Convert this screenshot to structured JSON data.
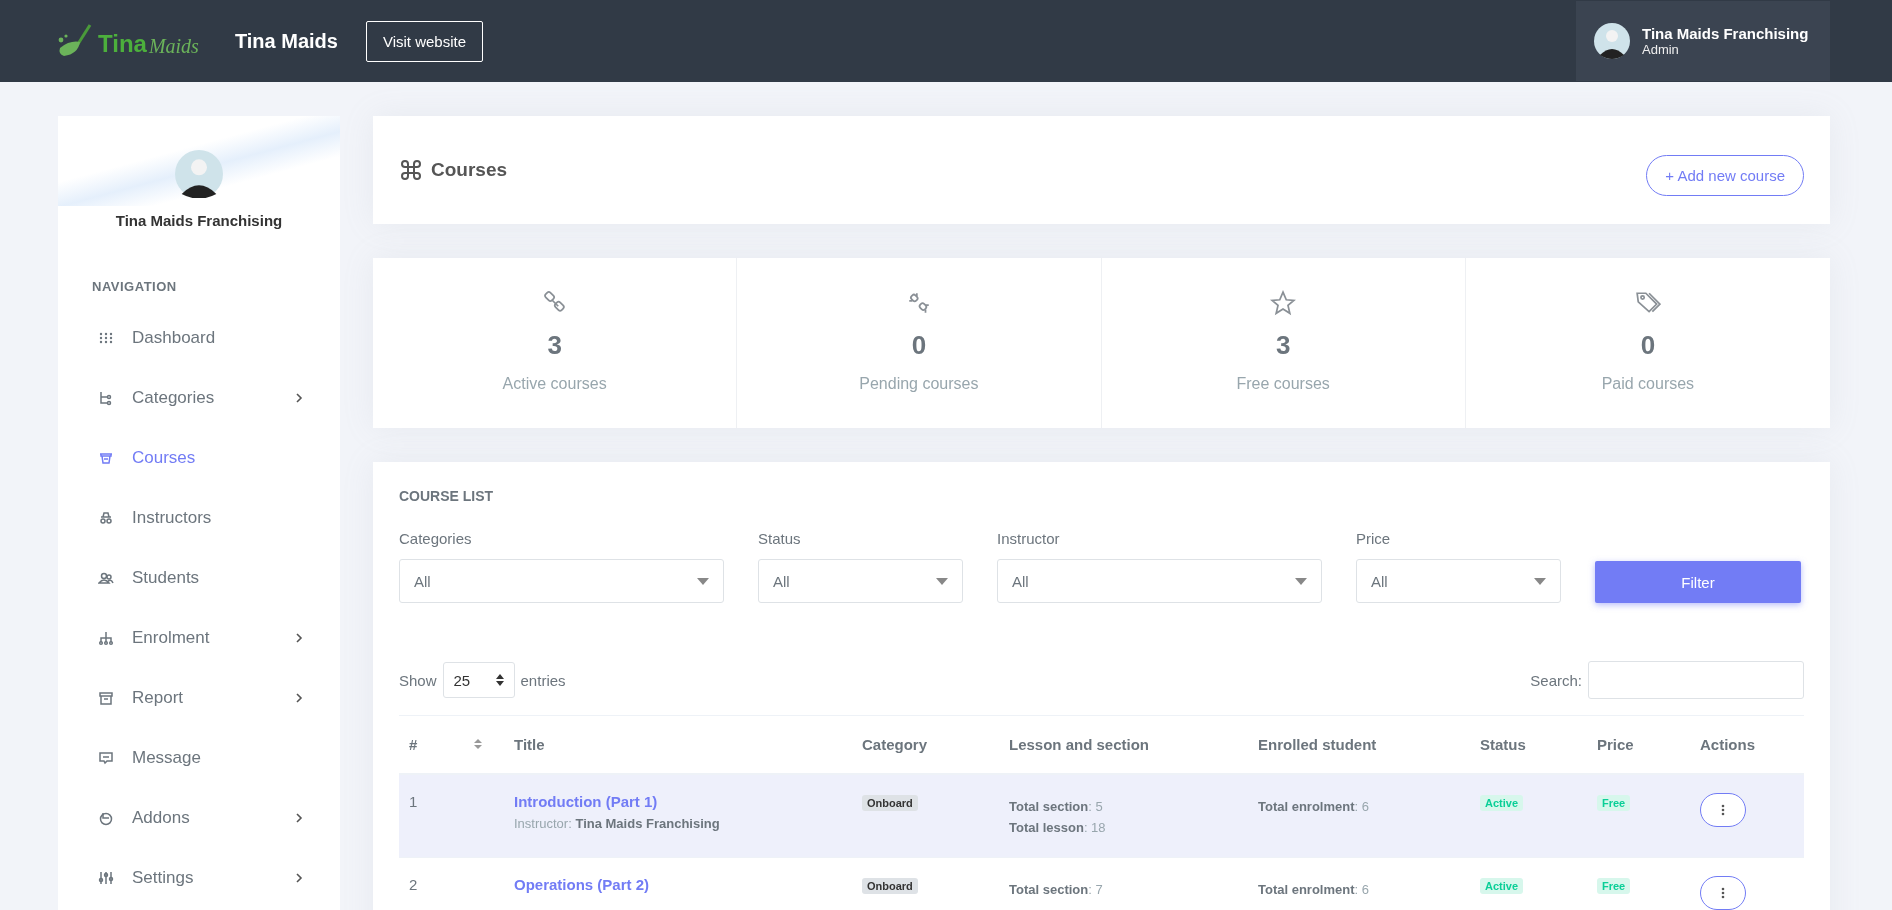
{
  "header": {
    "logo": {
      "word_1": "Tina",
      "word_2": "Maids"
    },
    "site_title": "Tina Maids",
    "visit_button": "Visit website",
    "user": {
      "name": "Tina Maids Franchising",
      "role": "Admin"
    }
  },
  "sidebar": {
    "user_name": "Tina Maids Franchising",
    "section_title": "NAVIGATION",
    "items": [
      {
        "label": "Dashboard",
        "selected": false,
        "has_submenu": false
      },
      {
        "label": "Categories",
        "selected": false,
        "has_submenu": true
      },
      {
        "label": "Courses",
        "selected": true,
        "has_submenu": false
      },
      {
        "label": "Instructors",
        "selected": false,
        "has_submenu": false
      },
      {
        "label": "Students",
        "selected": false,
        "has_submenu": false
      },
      {
        "label": "Enrolment",
        "selected": false,
        "has_submenu": true
      },
      {
        "label": "Report",
        "selected": false,
        "has_submenu": true
      },
      {
        "label": "Message",
        "selected": false,
        "has_submenu": false
      },
      {
        "label": "Addons",
        "selected": false,
        "has_submenu": true
      },
      {
        "label": "Settings",
        "selected": false,
        "has_submenu": true
      }
    ]
  },
  "page_header": {
    "title": "Courses",
    "add_button": "+ Add new course"
  },
  "stats": [
    {
      "value": "3",
      "label": "Active courses"
    },
    {
      "value": "0",
      "label": "Pending courses"
    },
    {
      "value": "3",
      "label": "Free courses"
    },
    {
      "value": "0",
      "label": "Paid courses"
    }
  ],
  "course_list": {
    "title": "COURSE LIST",
    "filters": [
      {
        "label": "Categories",
        "value": "All"
      },
      {
        "label": "Status",
        "value": "All"
      },
      {
        "label": "Instructor",
        "value": "All"
      },
      {
        "label": "Price",
        "value": "All"
      }
    ],
    "filter_button": "Filter",
    "show_label": "Show",
    "entries_value": "25",
    "entries_label": "entries",
    "search_label": "Search:",
    "table": {
      "columns": [
        "#",
        "Title",
        "Category",
        "Lesson and section",
        "Enrolled student",
        "Status",
        "Price",
        "Actions"
      ],
      "rows": [
        {
          "number": "1",
          "title": "Introduction (Part 1)",
          "instructor": "Instructor: **Tina Maids Franchising**",
          "category": "Onboard",
          "lessons": [
            "**Total section**: 5",
            "**Total lesson**: 18"
          ],
          "enrolment": "**Total enrolment**: 6",
          "status": "Active",
          "price": "Free",
          "highlighted": true
        },
        {
          "number": "2",
          "title": "Operations (Part 2)",
          "category": "Onboard",
          "lessons": [
            "**Total section**: 7"
          ],
          "enrolment": "**Total enrolment**: 6",
          "status": "Active",
          "price": "Free",
          "highlighted": false
        }
      ]
    }
  }
}
